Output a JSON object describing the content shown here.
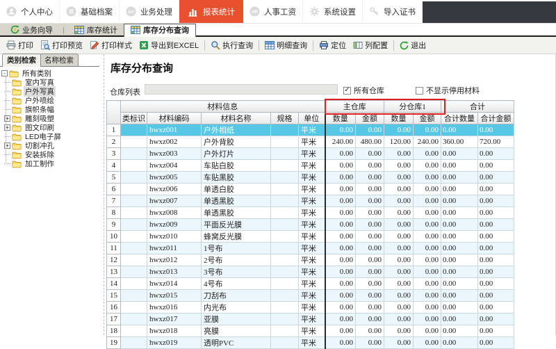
{
  "top_nav": {
    "active_color": "#e8502e",
    "fill_color": "#343a40",
    "items": [
      {
        "label": "个人中心",
        "icon": "person-icon",
        "active": false
      },
      {
        "label": "基础档案",
        "icon": "list-icon",
        "active": false
      },
      {
        "label": "业务处理",
        "icon": "ao-badge-icon",
        "active": false
      },
      {
        "label": "报表统计",
        "icon": "bar-chart-icon",
        "active": true
      },
      {
        "label": "人事工资",
        "icon": "hr-badge-icon",
        "active": false
      },
      {
        "label": "系统设置",
        "icon": "gear-icon",
        "active": false
      },
      {
        "label": "导入证书",
        "icon": "key-icon",
        "active": false
      }
    ]
  },
  "tab_bar": {
    "wizard": {
      "label": "业务向导",
      "icon": "wizard-icon"
    },
    "tabs": [
      {
        "label": "库存统计",
        "icon": "grid-icon",
        "active": false
      },
      {
        "label": "库存分布查询",
        "icon": "grid-icon",
        "active": true
      }
    ]
  },
  "toolbar": {
    "groups": [
      [
        {
          "label": "打印",
          "icon": "printer-icon"
        },
        {
          "label": "打印预览",
          "icon": "print-preview-icon"
        },
        {
          "label": "打印样式",
          "icon": "print-style-icon"
        },
        {
          "label": "导出到EXCEL",
          "icon": "excel-icon"
        }
      ],
      [
        {
          "label": "执行查询",
          "icon": "search-icon"
        }
      ],
      [
        {
          "label": "明细查询",
          "icon": "detail-grid-icon"
        }
      ],
      [
        {
          "label": "定位",
          "icon": "locate-icon"
        },
        {
          "label": "列配置",
          "icon": "columns-icon"
        }
      ],
      [
        {
          "label": "退出",
          "icon": "exit-icon"
        }
      ]
    ]
  },
  "sidebar": {
    "tabs": [
      {
        "label": "类别检索",
        "active": true
      },
      {
        "label": "名称检索",
        "active": false
      }
    ],
    "tree": {
      "root": {
        "label": "所有类别",
        "expander": "minus"
      },
      "items": [
        {
          "label": "室内写真"
        },
        {
          "label": "户外写真",
          "selected": true
        },
        {
          "label": "户外喷绘"
        },
        {
          "label": "旗帜条幅"
        },
        {
          "label": "雕刻吸塑",
          "expander": "plus"
        },
        {
          "label": "图文印刷",
          "expander": "plus"
        },
        {
          "label": "LED电子屏"
        },
        {
          "label": "切割冲孔",
          "expander": "plus"
        },
        {
          "label": "安装拆除"
        },
        {
          "label": "加工制作"
        }
      ]
    }
  },
  "content": {
    "title": "库存分布查询",
    "filter": {
      "warehouse_label": "仓库列表",
      "warehouse_value": "",
      "all_warehouses": {
        "label": "所有仓库",
        "checked": true
      },
      "hide_disabled": {
        "label": "不显示停用材料",
        "checked": false
      }
    },
    "table": {
      "group_headers": [
        {
          "label": "材料信息",
          "span": 5
        },
        {
          "label": "主仓库",
          "span": 2
        },
        {
          "label": "分仓库1",
          "span": 2
        },
        {
          "label": "合计",
          "span": 2
        }
      ],
      "columns": [
        "类标识",
        "材料编码",
        "材料名称",
        "规格",
        "单位",
        "数量",
        "金额",
        "数量",
        "金额",
        "合计数量",
        "合计金额"
      ],
      "annotation_color": "#e21f1f",
      "selected_row_color": "#57c7e6",
      "rows": [
        {
          "num": 1,
          "code": "hwxz001",
          "name": "户外相纸",
          "spec": "",
          "unit": "平米",
          "values": [
            "0.00",
            "0.00",
            "0.00",
            "0.00",
            "0.00",
            "0.00"
          ],
          "selected": true
        },
        {
          "num": 2,
          "code": "hwxz002",
          "name": "户外背胶",
          "spec": "",
          "unit": "平米",
          "values": [
            "240.00",
            "480.00",
            "120.00",
            "240.00",
            "360.00",
            "720.00"
          ]
        },
        {
          "num": 3,
          "code": "hwxz003",
          "name": "户外灯片",
          "spec": "",
          "unit": "平米",
          "values": [
            "0.00",
            "0.00",
            "0.00",
            "0.00",
            "0.00",
            "0.00"
          ]
        },
        {
          "num": 4,
          "code": "hwxz004",
          "name": "车贴白胶",
          "spec": "",
          "unit": "平米",
          "values": [
            "0.00",
            "0.00",
            "0.00",
            "0.00",
            "0.00",
            "0.00"
          ]
        },
        {
          "num": 5,
          "code": "hwxz005",
          "name": "车贴黑胶",
          "spec": "",
          "unit": "平米",
          "values": [
            "0.00",
            "0.00",
            "0.00",
            "0.00",
            "0.00",
            "0.00"
          ]
        },
        {
          "num": 6,
          "code": "hwxz006",
          "name": "单透白胶",
          "spec": "",
          "unit": "平米",
          "values": [
            "0.00",
            "0.00",
            "0.00",
            "0.00",
            "0.00",
            "0.00"
          ]
        },
        {
          "num": 7,
          "code": "hwxz007",
          "name": "单透黑胶",
          "spec": "",
          "unit": "平米",
          "values": [
            "0.00",
            "0.00",
            "0.00",
            "0.00",
            "0.00",
            "0.00"
          ]
        },
        {
          "num": 8,
          "code": "hwxz008",
          "name": "单透黑胶",
          "spec": "",
          "unit": "平米",
          "values": [
            "0.00",
            "0.00",
            "0.00",
            "0.00",
            "0.00",
            "0.00"
          ]
        },
        {
          "num": 9,
          "code": "hwxz009",
          "name": "平面反光膜",
          "spec": "",
          "unit": "平米",
          "values": [
            "0.00",
            "0.00",
            "0.00",
            "0.00",
            "0.00",
            "0.00"
          ]
        },
        {
          "num": 10,
          "code": "hwxz010",
          "name": "蜂窝反光膜",
          "spec": "",
          "unit": "平米",
          "values": [
            "0.00",
            "0.00",
            "0.00",
            "0.00",
            "0.00",
            "0.00"
          ]
        },
        {
          "num": 11,
          "code": "hwxz011",
          "name": "1号布",
          "spec": "",
          "unit": "平米",
          "values": [
            "0.00",
            "0.00",
            "0.00",
            "0.00",
            "0.00",
            "0.00"
          ]
        },
        {
          "num": 12,
          "code": "hwxz012",
          "name": "2号布",
          "spec": "",
          "unit": "平米",
          "values": [
            "0.00",
            "0.00",
            "0.00",
            "0.00",
            "0.00",
            "0.00"
          ]
        },
        {
          "num": 13,
          "code": "hwxz013",
          "name": "3号布",
          "spec": "",
          "unit": "平米",
          "values": [
            "0.00",
            "0.00",
            "0.00",
            "0.00",
            "0.00",
            "0.00"
          ]
        },
        {
          "num": 14,
          "code": "hwxz014",
          "name": "4号布",
          "spec": "",
          "unit": "平米",
          "values": [
            "0.00",
            "0.00",
            "0.00",
            "0.00",
            "0.00",
            "0.00"
          ]
        },
        {
          "num": 15,
          "code": "hwxz015",
          "name": "刀刮布",
          "spec": "",
          "unit": "平米",
          "values": [
            "0.00",
            "0.00",
            "0.00",
            "0.00",
            "0.00",
            "0.00"
          ]
        },
        {
          "num": 16,
          "code": "hwxz016",
          "name": "内光布",
          "spec": "",
          "unit": "平米",
          "values": [
            "0.00",
            "0.00",
            "0.00",
            "0.00",
            "0.00",
            "0.00"
          ]
        },
        {
          "num": 17,
          "code": "hwxz017",
          "name": "亚膜",
          "spec": "",
          "unit": "平米",
          "values": [
            "0.00",
            "0.00",
            "0.00",
            "0.00",
            "0.00",
            "0.00"
          ]
        },
        {
          "num": 18,
          "code": "hwxz018",
          "name": "亮膜",
          "spec": "",
          "unit": "平米",
          "values": [
            "0.00",
            "0.00",
            "0.00",
            "0.00",
            "0.00",
            "0.00"
          ]
        },
        {
          "num": 19,
          "code": "hwxz019",
          "name": "透明PVC",
          "spec": "",
          "unit": "平米",
          "values": [
            "0.00",
            "0.00",
            "0.00",
            "0.00",
            "0.00",
            "0.00"
          ]
        }
      ]
    }
  }
}
